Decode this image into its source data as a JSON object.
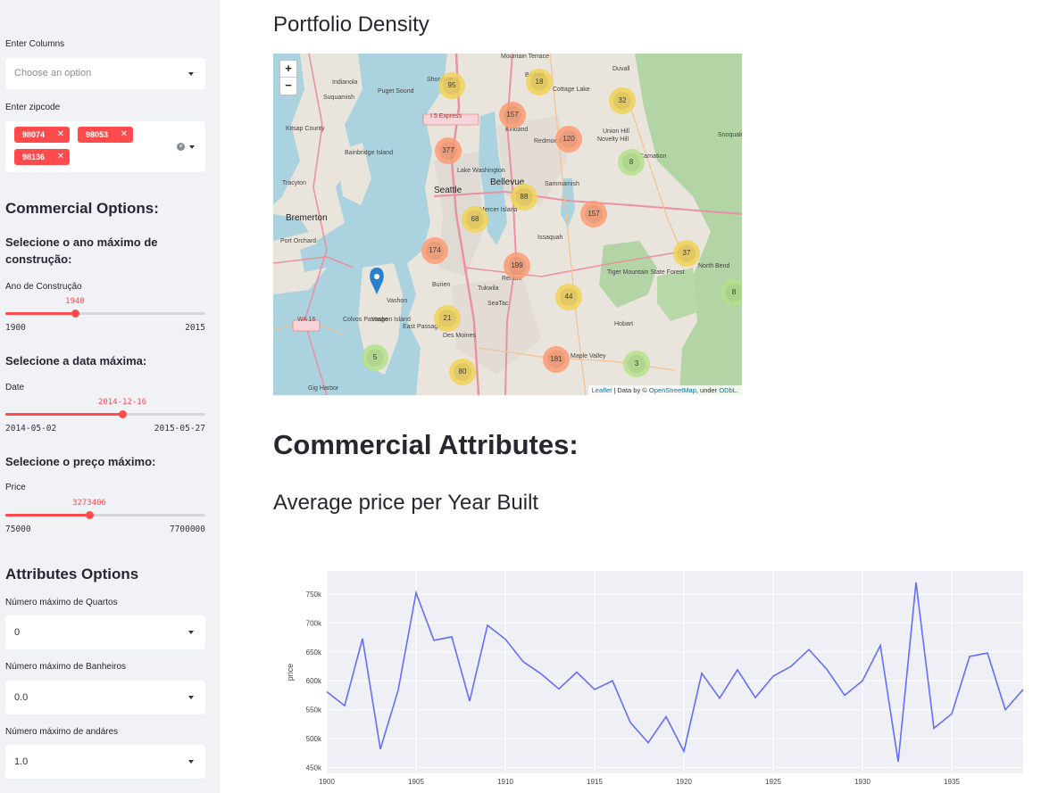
{
  "sidebar": {
    "columns_label": "Enter Columns",
    "columns_placeholder": "Choose an option",
    "zipcode_label": "Enter zipcode",
    "zipcodes": [
      "98074",
      "98053",
      "98136"
    ],
    "commercial_header": "Commercial Options:",
    "year_subheader": "Selecione o ano máximo de construção:",
    "year_slider": {
      "label": "Ano de Construção",
      "value": "1940",
      "min": "1900",
      "max": "2015",
      "fraction": 0.348
    },
    "date_subheader": "Selecione a data máxima:",
    "date_slider": {
      "label": "Date",
      "value": "2014-12-16",
      "min": "2014-05-02",
      "max": "2015-05-27",
      "fraction": 0.584
    },
    "price_subheader": "Selecione o preço máximo:",
    "price_slider": {
      "label": "Price",
      "value": "3273406",
      "min": "75000",
      "max": "7700000",
      "fraction": 0.419
    },
    "attributes_header": "Attributes Options",
    "bedrooms_label": "Número máximo de Quartos",
    "bedrooms_value": "0",
    "bathrooms_label": "Número máximo de Banheiros",
    "bathrooms_value": "0.0",
    "floors_label": "Número máximo de andáres",
    "floors_value": "1.0"
  },
  "main": {
    "portfolio_title": "Portfolio Density",
    "commercial_title": "Commercial Attributes:",
    "avg_price_title": "Average price per Year Built"
  },
  "map": {
    "zoom_in": "+",
    "zoom_out": "−",
    "attribution_leaflet": "Leaflet",
    "attribution_text": " | Data by © ",
    "attribution_osm": "OpenStreetMap",
    "attribution_under": ", under ",
    "attribution_odbl": "ODbL.",
    "places": [
      "Shoreline",
      "Bothell",
      "Cottage Lake",
      "Indianola",
      "Puget Sound",
      "Suquamish",
      "I 5 Express",
      "Kirkland",
      "Redmond",
      "Union Hill",
      "Novelty Hill",
      "Kitsap County",
      "Bainbridge Island",
      "Seattle",
      "Lake Washington",
      "Bellevue",
      "Mercer Island",
      "Sammamish",
      "Bremerton",
      "Port Orchard",
      "Issaquah",
      "North Bend",
      "Burien",
      "Tukwila",
      "Renton",
      "SeaTac",
      "Vashon",
      "Vashon Island",
      "East Passage",
      "Des Moines",
      "Tiger Mountain State Forest",
      "Hobart",
      "Maple Valley",
      "Gig Harbor",
      "WA 16",
      "Mountain Terrace",
      "Duvall",
      "Carnation",
      "Snoqualmie",
      "Tracyton",
      "Colvos Passage"
    ],
    "clusters": [
      {
        "count": "95",
        "level": "yellow"
      },
      {
        "count": "18",
        "level": "yellow"
      },
      {
        "count": "32",
        "level": "yellow"
      },
      {
        "count": "157",
        "level": "orange"
      },
      {
        "count": "120",
        "level": "orange"
      },
      {
        "count": "377",
        "level": "orange"
      },
      {
        "count": "8",
        "level": "green"
      },
      {
        "count": "88",
        "level": "yellow"
      },
      {
        "count": "68",
        "level": "yellow"
      },
      {
        "count": "157",
        "level": "orange"
      },
      {
        "count": "174",
        "level": "orange"
      },
      {
        "count": "199",
        "level": "orange"
      },
      {
        "count": "37",
        "level": "yellow"
      },
      {
        "count": "8",
        "level": "green"
      },
      {
        "count": "44",
        "level": "yellow"
      },
      {
        "count": "21",
        "level": "yellow"
      },
      {
        "count": "5",
        "level": "green"
      },
      {
        "count": "80",
        "level": "yellow"
      },
      {
        "count": "181",
        "level": "orange"
      },
      {
        "count": "3",
        "level": "green"
      }
    ],
    "colors": {
      "yellow": "#f1d357",
      "orange": "#fd9c73",
      "green": "#b5e28c",
      "water": "#aad3df",
      "land": "#e9e4da",
      "forest": "#add19e",
      "road": "#e892a2"
    }
  },
  "chart_data": {
    "type": "line",
    "title": "",
    "xlabel": "",
    "ylabel": "price",
    "x": [
      1900,
      1901,
      1902,
      1903,
      1904,
      1905,
      1906,
      1907,
      1908,
      1909,
      1910,
      1911,
      1912,
      1913,
      1914,
      1915,
      1916,
      1917,
      1918,
      1919,
      1920,
      1921,
      1922,
      1923,
      1924,
      1925,
      1926,
      1927,
      1928,
      1929,
      1930,
      1931,
      1932,
      1933,
      1934,
      1935,
      1936,
      1937,
      1938,
      1939
    ],
    "values": [
      581000,
      557000,
      673000,
      482000,
      584000,
      752000,
      670000,
      676000,
      565000,
      696000,
      672000,
      633000,
      612000,
      586000,
      615000,
      585000,
      600000,
      528000,
      493000,
      538000,
      478000,
      613000,
      570000,
      619000,
      571000,
      608000,
      625000,
      654000,
      620000,
      575000,
      600000,
      661000,
      460000,
      770000,
      518000,
      543000,
      642000,
      648000,
      550000,
      585000
    ],
    "xlim": [
      1900,
      1939
    ],
    "ylim": [
      440000,
      790000
    ],
    "xticks": [
      "1900",
      "1905",
      "1910",
      "1915",
      "1920",
      "1925",
      "1930",
      "1935"
    ],
    "yticks": [
      "450k",
      "500k",
      "550k",
      "600k",
      "650k",
      "700k",
      "750k"
    ],
    "grid": true,
    "line_color": "#636efa",
    "plot_bg": "#e5ecf6"
  }
}
